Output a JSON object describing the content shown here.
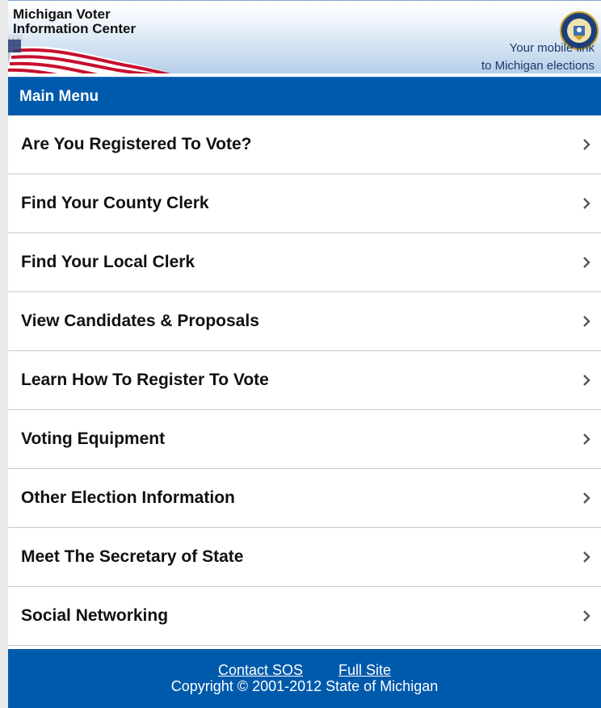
{
  "header": {
    "title_line1": "Michigan Voter",
    "title_line2": "Information Center",
    "tagline_line1": "Your mobile link",
    "tagline_line2": "to Michigan elections",
    "seal_icon": "michigan-seal-icon"
  },
  "menu_bar": {
    "title": "Main Menu"
  },
  "menu": {
    "items": [
      {
        "label": "Are You Registered To Vote?"
      },
      {
        "label": "Find Your County Clerk"
      },
      {
        "label": "Find Your Local Clerk"
      },
      {
        "label": "View Candidates & Proposals"
      },
      {
        "label": "Learn How To Register To Vote"
      },
      {
        "label": "Voting Equipment"
      },
      {
        "label": "Other Election Information"
      },
      {
        "label": "Meet The Secretary of State"
      },
      {
        "label": "Social Networking"
      }
    ],
    "chevron_icon": "chevron-right-icon"
  },
  "footer": {
    "contact_link": "Contact SOS",
    "full_site_link": "Full Site",
    "copyright": "Copyright © 2001-2012 State of Michigan"
  },
  "colors": {
    "brand_blue": "#005aab",
    "menu_text": "#111111",
    "divider": "#c9c9c9"
  }
}
